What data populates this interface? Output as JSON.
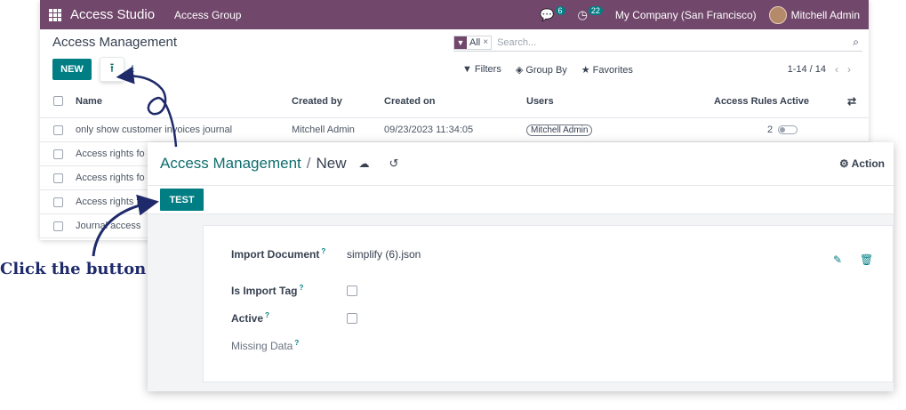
{
  "navbar": {
    "app_name": "Access Studio",
    "menu": "Access Group",
    "messages_count": "6",
    "activity_count": "22",
    "company": "My Company (San Francisco)",
    "user": "Mitchell Admin"
  },
  "list": {
    "breadcrumb": "Access Management",
    "search": {
      "facet": "All",
      "placeholder": "Search..."
    },
    "buttons": {
      "new": "NEW"
    },
    "tools": {
      "filters": "Filters",
      "group_by": "Group By",
      "favorites": "Favorites"
    },
    "pager": "1-14 / 14",
    "columns": {
      "name": "Name",
      "created_by": "Created by",
      "created_on": "Created on",
      "users": "Users",
      "access_rules": "Access Rules",
      "active": "Active"
    },
    "rows": [
      {
        "name": "only show customer invoices journal",
        "created_by": "Mitchell Admin",
        "created_on": "09/23/2023 11:34:05",
        "user": "Mitchell Admin",
        "rules": "2"
      },
      {
        "name": "Access rights fo"
      },
      {
        "name": "Access rights fo"
      },
      {
        "name": "Access rights fo"
      },
      {
        "name": "Journal access"
      }
    ]
  },
  "form": {
    "breadcrumb_parent": "Access Management",
    "breadcrumb_sep": "/",
    "breadcrumb_current": "New",
    "action_label": "Action",
    "test_button": "TEST",
    "fields": {
      "import_document": {
        "label": "Import Document",
        "value": "simplify (6).json"
      },
      "is_import_tag": {
        "label": "Is Import Tag"
      },
      "active": {
        "label": "Active"
      },
      "missing_data": {
        "label": "Missing Data"
      }
    },
    "help_mark": "?"
  },
  "annotation": {
    "text": "Click the button",
    "color": "#1f2a6b"
  },
  "colors": {
    "navbar": "#71476b",
    "primary": "#017e84"
  }
}
